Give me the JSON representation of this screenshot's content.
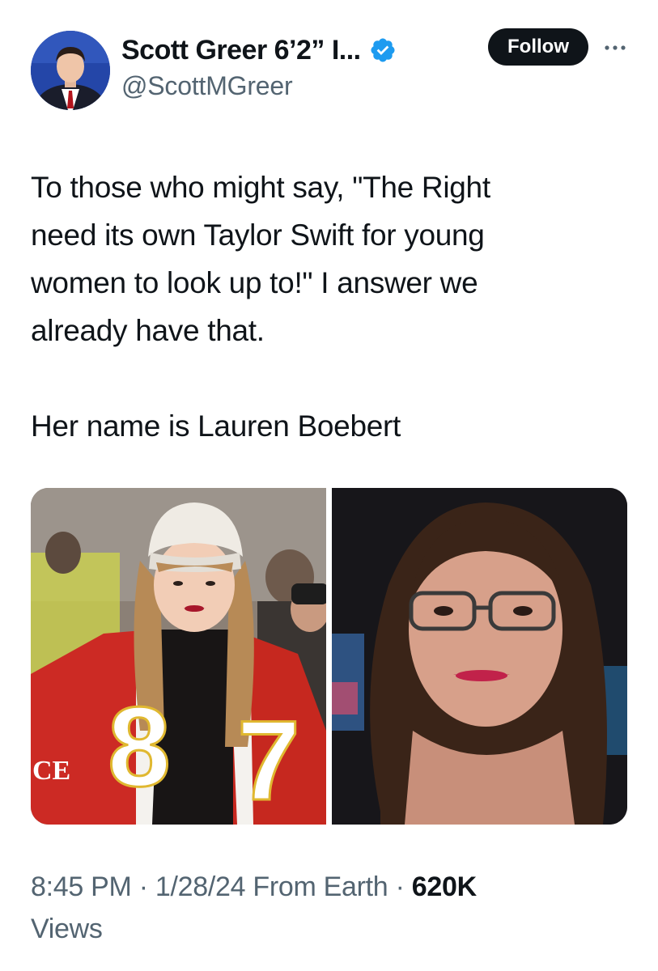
{
  "author": {
    "display_name": "Scott Greer 6’2” I...",
    "handle": "@ScottMGreer",
    "avatar_icon": "profile-avatar",
    "verified_icon": "verified-badge-icon",
    "verified_color": "#1d9bf0"
  },
  "actions": {
    "follow_label": "Follow",
    "more_icon": "more-options-icon"
  },
  "tweet": {
    "lines": [
      "To those who might say, \"The Right",
      "need its own Taylor Swift for young",
      "women to look up to!\" I answer we",
      "already have that."
    ],
    "closing": "Her name is Lauren Boebert"
  },
  "media": {
    "left_photo_text": {
      "jacket_number_left": "8",
      "jacket_number_right": "7",
      "sleeve_text": "CE"
    }
  },
  "meta": {
    "time": "8:45 PM",
    "separator": "·",
    "date": "1/28/24",
    "source": "From Earth",
    "views_count": "620K",
    "views_label": "Views"
  }
}
